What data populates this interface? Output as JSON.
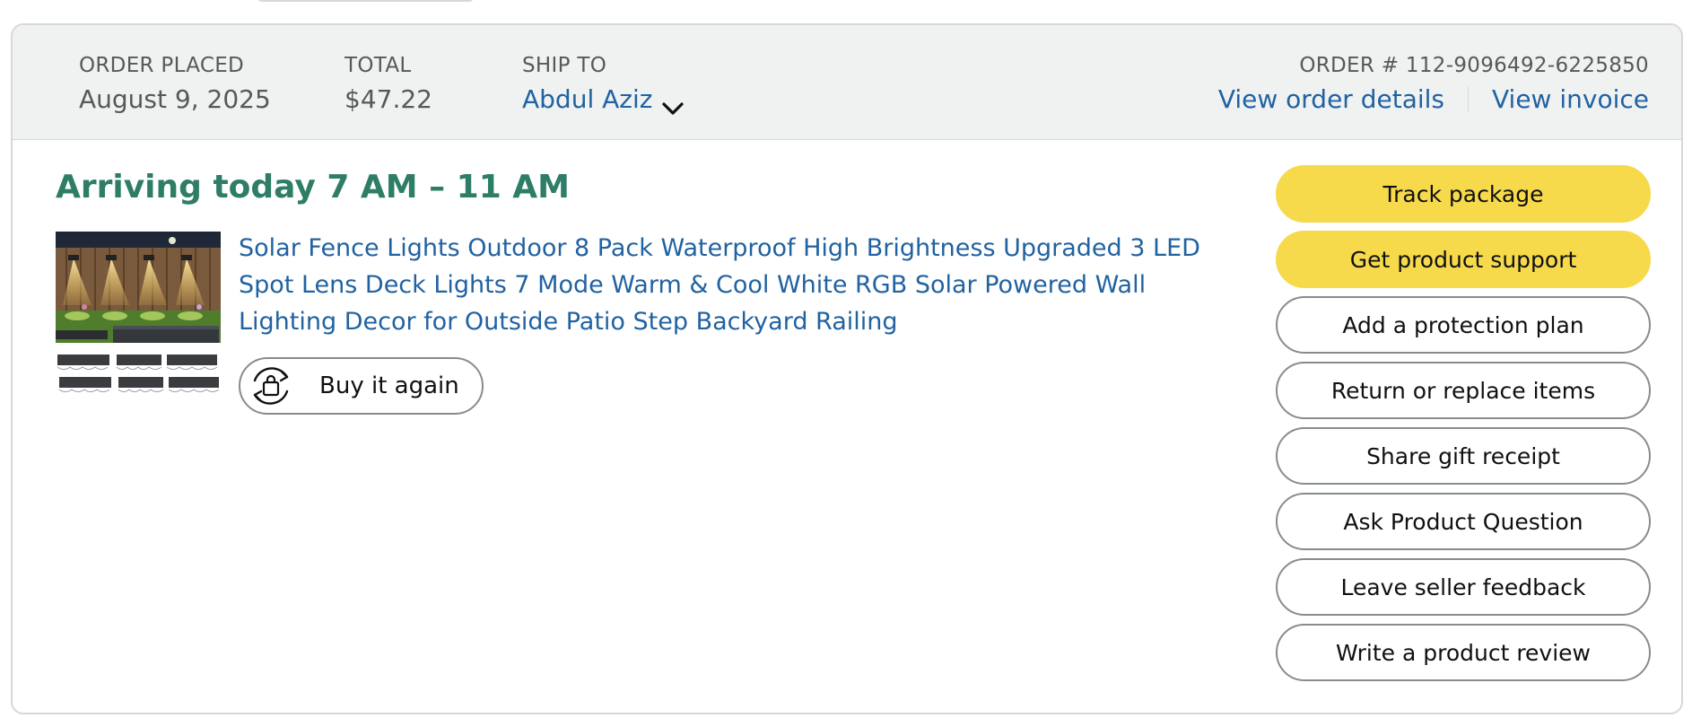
{
  "order": {
    "placed_label": "ORDER PLACED",
    "placed_value": "August 9, 2025",
    "total_label": "TOTAL",
    "total_value": "$47.22",
    "ship_to_label": "SHIP TO",
    "ship_to_value": "Abdul Aziz",
    "order_number_label": "ORDER # 112-9096492-6225850",
    "view_details_label": "View order details",
    "view_invoice_label": "View invoice"
  },
  "shipment": {
    "status": "Arriving today 7 AM – 11 AM"
  },
  "product": {
    "title": "Solar Fence Lights Outdoor 8 Pack Waterproof High Brightness Upgraded 3 LED Spot Lens Deck Lights 7 Mode Warm & Cool White RGB Solar Powered Wall Lighting Decor for Outside Patio Step Backyard Railing",
    "buy_again_label": "Buy it again",
    "image_icon": "product-thumbnail",
    "buy_again_icon": "reorder-bag-icon"
  },
  "actions": [
    {
      "label": "Track package",
      "primary": true
    },
    {
      "label": "Get product support",
      "primary": true
    },
    {
      "label": "Add a protection plan",
      "primary": false
    },
    {
      "label": "Return or replace items",
      "primary": false
    },
    {
      "label": "Share gift receipt",
      "primary": false
    },
    {
      "label": "Ask Product Question",
      "primary": false
    },
    {
      "label": "Leave seller feedback",
      "primary": false
    },
    {
      "label": "Write a product review",
      "primary": false
    }
  ],
  "colors": {
    "header_bg": "#f0f2f2",
    "link": "#2162a1",
    "arriving": "#2e7d66",
    "primary_button": "#f7d94c",
    "border": "#888c8c"
  }
}
